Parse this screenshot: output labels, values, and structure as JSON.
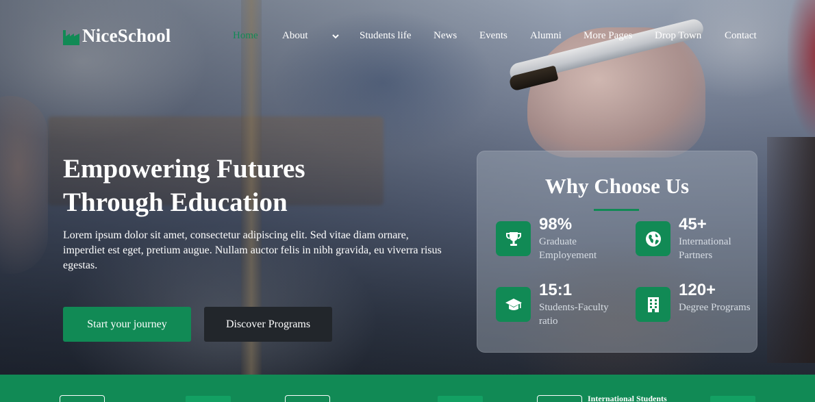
{
  "brand": {
    "name": "NiceSchool",
    "logo_icon": "factory-icon",
    "accent": "#118a55"
  },
  "nav": {
    "items": [
      {
        "label": "Home",
        "active": true
      },
      {
        "label": "About",
        "active": false
      },
      {
        "label": "Students life",
        "active": false
      },
      {
        "label": "News",
        "active": false
      },
      {
        "label": "Events",
        "active": false
      },
      {
        "label": "Alumni",
        "active": false
      },
      {
        "label": "More Pages",
        "active": false
      },
      {
        "label": "Drop Town",
        "active": false
      },
      {
        "label": "Contact",
        "active": false
      }
    ],
    "about_dropdown_icon": "chevron-down-icon"
  },
  "hero": {
    "title_line1": "Empowering Futures",
    "title_line2": "Through Education",
    "description": "Lorem ipsum dolor sit amet, consectetur adipiscing elit. Sed vitae diam ornare, imperdiet est eget, pretium augue. Nullam auctor felis in nibh gravida, eu viverra risus egestas.",
    "primary_button": "Start your journey",
    "secondary_button": "Discover Programs"
  },
  "why": {
    "title": "Why Choose Us",
    "stats": [
      {
        "value": "98%",
        "label": "Graduate Employement",
        "icon": "trophy-icon"
      },
      {
        "value": "45+",
        "label": "International Partners",
        "icon": "globe-icon"
      },
      {
        "value": "15:1",
        "label": "Students-Faculty ratio",
        "icon": "graduation-cap-icon"
      },
      {
        "value": "120+",
        "label": "Degree Programs",
        "icon": "building-icon"
      }
    ]
  },
  "band": {
    "partial_text": "International Students"
  }
}
